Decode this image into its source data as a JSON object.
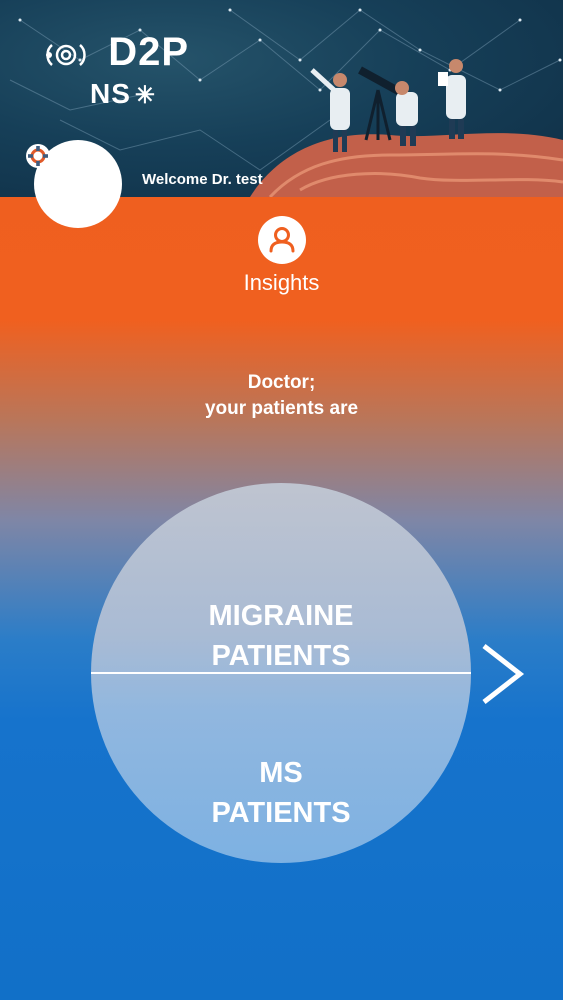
{
  "header": {
    "logo_main": "D2P",
    "logo_sub": "NS",
    "welcome_text": "Welcome Dr. test"
  },
  "nav": {
    "insights_label": "Insights"
  },
  "main": {
    "subtitle_line1": "Doctor;",
    "subtitle_line2": "your patients are",
    "option_top_line1": "MIGRAINE",
    "option_top_line2": "PATIENTS",
    "option_bottom_line1": "MS",
    "option_bottom_line2": "PATIENTS"
  },
  "colors": {
    "accent_orange": "#ef5f1f",
    "accent_blue": "#1170c8",
    "header_navy": "#163f58"
  },
  "icons": {
    "settings": "gear-icon",
    "insights": "user-icon",
    "next": "chevron-right-icon"
  }
}
